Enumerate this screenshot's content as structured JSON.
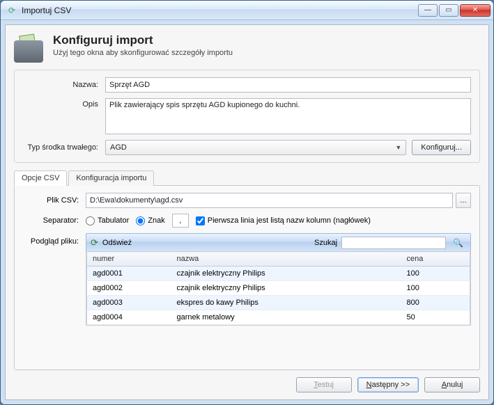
{
  "window": {
    "title": "Importuj CSV"
  },
  "header": {
    "title": "Konfiguruj import",
    "subtitle": "Użyj tego okna aby skonfigurować szczegóły importu"
  },
  "form": {
    "name_label": "Nazwa:",
    "name_value": "Sprzęt AGD",
    "desc_label": "Opis",
    "desc_value": "Plik zawierający spis sprzętu AGD kupionego do kuchni.",
    "type_label": "Typ środka trwałego:",
    "type_value": "AGD",
    "configure_label": "Konfiguruj..."
  },
  "tabs": {
    "csv": "Opcje CSV",
    "mapping": "Konfiguracja importu"
  },
  "csv": {
    "file_label": "Plik CSV:",
    "file_value": "D:\\Ewa\\dokumenty\\agd.csv",
    "separator_label": "Separator:",
    "radio_tab": "Tabulator",
    "radio_char": "Znak",
    "char_value": ",",
    "header_check": "Pierwsza linia jest listą nazw kolumn (nagłówek)",
    "preview_label": "Podgląd pliku:",
    "refresh_label": "Odśwież",
    "search_label": "Szukaj"
  },
  "table": {
    "columns": [
      "numer",
      "nazwa",
      "cena"
    ],
    "rows": [
      {
        "c0": "agd0001",
        "c1": "czajnik elektryczny Philips",
        "c2": "100"
      },
      {
        "c0": "agd0002",
        "c1": "czajnik elektryczny Philips",
        "c2": "100"
      },
      {
        "c0": "agd0003",
        "c1": "ekspres do kawy Philips",
        "c2": "800"
      },
      {
        "c0": "agd0004",
        "c1": "garnek metalowy",
        "c2": "50"
      }
    ]
  },
  "footer": {
    "test": "Testuj",
    "next": "Następny >>",
    "cancel": "Anuluj"
  }
}
